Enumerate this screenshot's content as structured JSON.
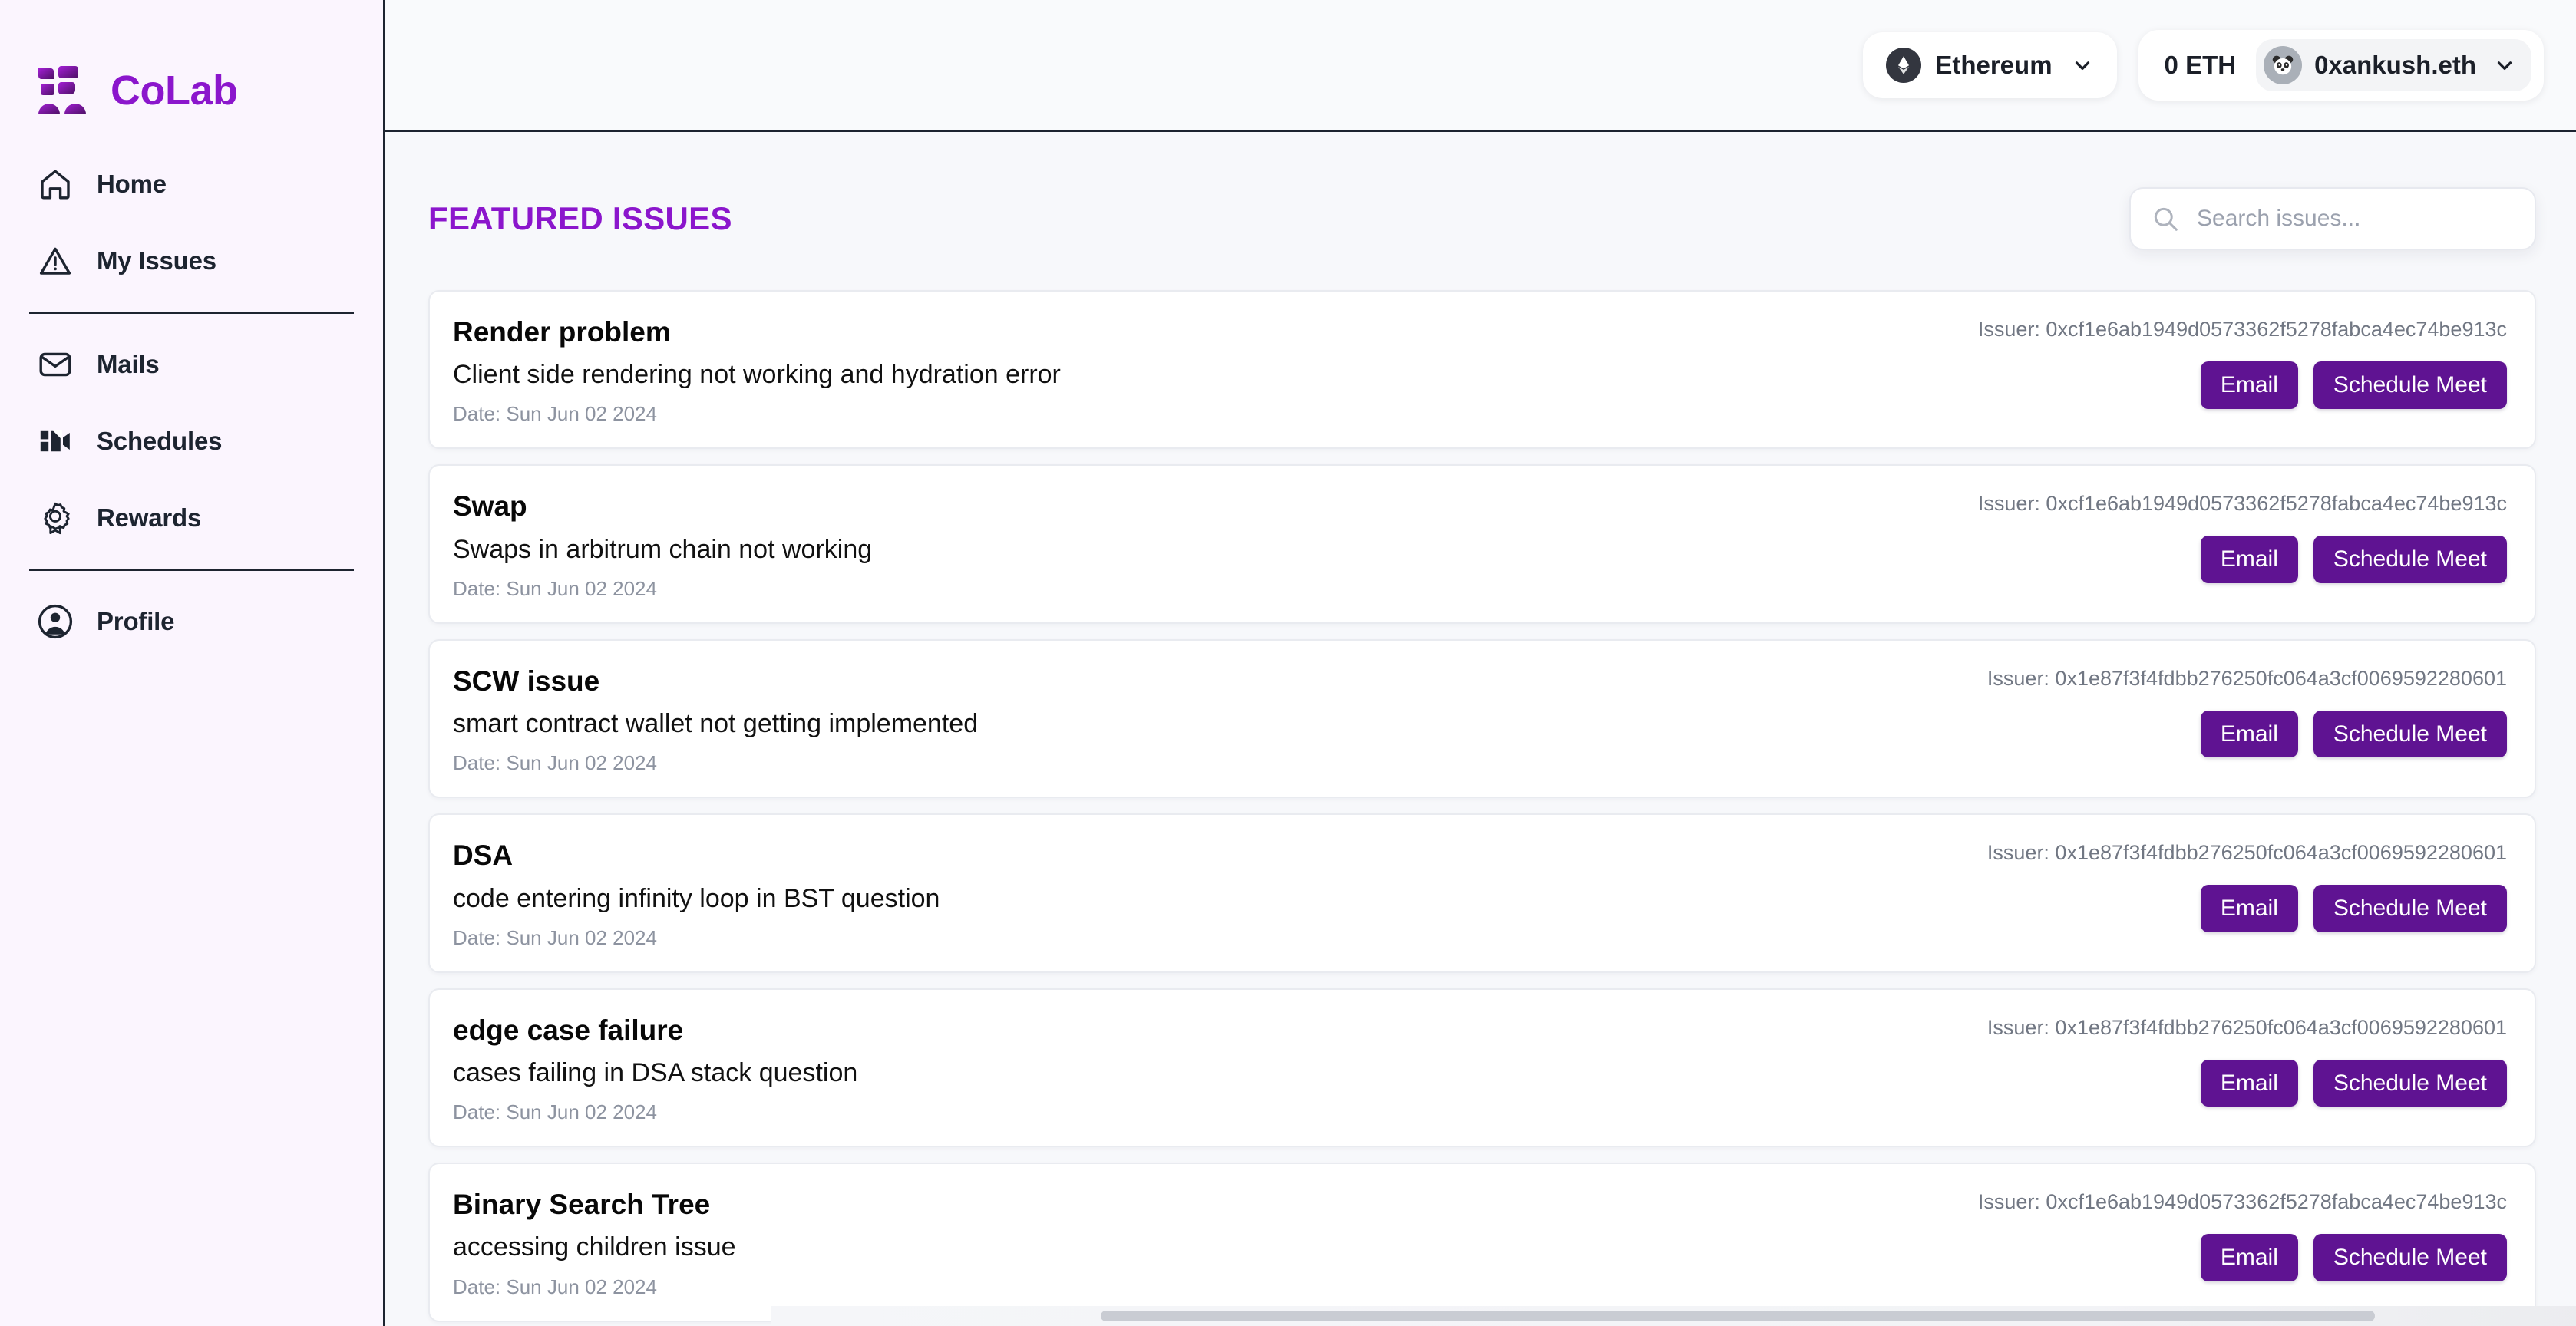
{
  "brand": {
    "name": "CoLab",
    "logo_icon": "colab-logo-icon",
    "color": "#8b16cc"
  },
  "sidebar": {
    "groups": [
      {
        "items": [
          {
            "label": "Home",
            "icon": "home-icon"
          },
          {
            "label": "My Issues",
            "icon": "warning-triangle-icon"
          }
        ]
      },
      {
        "items": [
          {
            "label": "Mails",
            "icon": "envelope-icon"
          },
          {
            "label": "Schedules",
            "icon": "video-camera-icon"
          },
          {
            "label": "Rewards",
            "icon": "award-ribbon-icon"
          }
        ]
      },
      {
        "items": [
          {
            "label": "Profile",
            "icon": "user-avatar-icon"
          }
        ]
      }
    ]
  },
  "topbar": {
    "chain": {
      "label": "Ethereum",
      "icon": "ethereum-icon",
      "chevron": "chevron-down-icon"
    },
    "account": {
      "balance": "0 ETH",
      "name": "0xankush.eth",
      "avatar_icon": "panda-avatar-icon",
      "chevron": "chevron-down-icon"
    }
  },
  "content": {
    "page_title": "FEATURED ISSUES",
    "search": {
      "placeholder": "Search issues...",
      "value": "",
      "icon": "search-icon"
    },
    "buttons": {
      "email": "Email",
      "schedule": "Schedule Meet"
    },
    "issuer_prefix": "Issuer: ",
    "issues": [
      {
        "title": "Render problem",
        "description": "Client side rendering not working and hydration error",
        "date": "Date: Sun Jun 02 2024",
        "issuer": "Issuer: 0xcf1e6ab1949d0573362f5278fabca4ec74be913c",
        "email_label": "Email",
        "schedule_label": "Schedule Meet"
      },
      {
        "title": "Swap",
        "description": "Swaps in arbitrum chain not working",
        "date": "Date: Sun Jun 02 2024",
        "issuer": "Issuer: 0xcf1e6ab1949d0573362f5278fabca4ec74be913c",
        "email_label": "Email",
        "schedule_label": "Schedule Meet"
      },
      {
        "title": "SCW issue",
        "description": "smart contract wallet not getting implemented",
        "date": "Date: Sun Jun 02 2024",
        "issuer": "Issuer: 0x1e87f3f4fdbb276250fc064a3cf0069592280601",
        "email_label": "Email",
        "schedule_label": "Schedule Meet"
      },
      {
        "title": "DSA",
        "description": "code entering infinity loop in BST question",
        "date": "Date: Sun Jun 02 2024",
        "issuer": "Issuer: 0x1e87f3f4fdbb276250fc064a3cf0069592280601",
        "email_label": "Email",
        "schedule_label": "Schedule Meet"
      },
      {
        "title": "edge case failure",
        "description": "cases failing in DSA stack question",
        "date": "Date: Sun Jun 02 2024",
        "issuer": "Issuer: 0x1e87f3f4fdbb276250fc064a3cf0069592280601",
        "email_label": "Email",
        "schedule_label": "Schedule Meet"
      },
      {
        "title": "Binary Search Tree",
        "description": "accessing children issue",
        "date": "Date: Sun Jun 02 2024",
        "issuer": "Issuer: 0xcf1e6ab1949d0573362f5278fabca4ec74be913c",
        "email_label": "Email",
        "schedule_label": "Schedule Meet"
      }
    ]
  },
  "colors": {
    "brand_purple": "#8b16cc",
    "button_purple": "#5f1392",
    "sidebar_bg": "#fbf5fe",
    "main_bg": "#f7f8fb",
    "text_dark": "#1d2430",
    "muted": "#8d93a0"
  }
}
